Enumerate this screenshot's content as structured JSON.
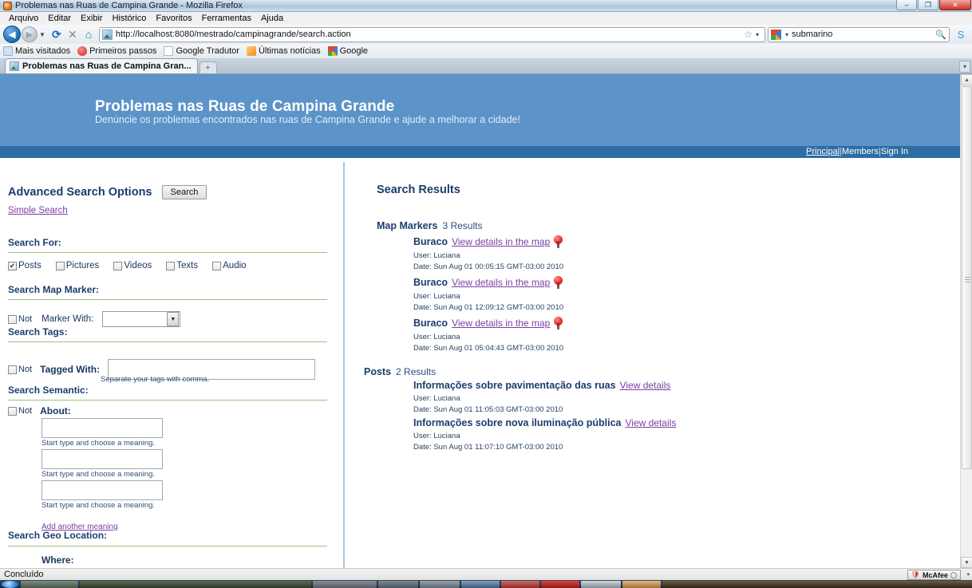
{
  "window": {
    "title": "Problemas nas Ruas de Campina Grande - Mozilla Firefox",
    "minimize": "–",
    "maximize": "❐",
    "close": "✕"
  },
  "menu": [
    "Arquivo",
    "Editar",
    "Exibir",
    "Histórico",
    "Favoritos",
    "Ferramentas",
    "Ajuda"
  ],
  "toolbar": {
    "back_icon": "◀",
    "forward_icon": "▶",
    "dropdown_caret": "▼",
    "reload_icon": "⟳",
    "stop_icon": "✕",
    "home_icon": "⌂",
    "url": "http://localhost:8080/mestrado/campinagrande/search.action",
    "star_icon": "☆",
    "star_caret": "▾",
    "search_engine_caret": "▾",
    "search_value": "submarino",
    "search_icon": "🔍",
    "extension_icon": "S"
  },
  "bookmarks": [
    {
      "label": "Mais visitados",
      "icon": "blue"
    },
    {
      "label": "Primeiros passos",
      "icon": "red"
    },
    {
      "label": "Google Tradutor",
      "icon": "page"
    },
    {
      "label": "Últimas notícias",
      "icon": "rss"
    },
    {
      "label": "Google",
      "icon": "g"
    }
  ],
  "tabs": {
    "active_label": "Problemas nas Ruas de Campina Gran...",
    "new_tab_icon": "+",
    "list_all_icon": "▾"
  },
  "page": {
    "title": "Problemas nas Ruas de Campina Grande",
    "subtitle": "Denúncie os problemas encontrados nas ruas de Campina Grande e ajude a melhorar a cidade!",
    "nav": {
      "principal": "Principal",
      "members": "Members",
      "signin": "Sign In",
      "separator": "|"
    }
  },
  "sidebar": {
    "heading": "Advanced Search Options",
    "search_button": "Search",
    "simple_search_link": "Simple Search",
    "search_for": {
      "heading": "Search For:",
      "options": [
        {
          "label": "Posts",
          "checked": true
        },
        {
          "label": "Pictures",
          "checked": false
        },
        {
          "label": "Videos",
          "checked": false
        },
        {
          "label": "Texts",
          "checked": false
        },
        {
          "label": "Audio",
          "checked": false
        }
      ]
    },
    "map_marker": {
      "heading": "Search Map Marker:",
      "not_label": "Not",
      "field_label": "Marker With:",
      "select_value": "",
      "select_caret": "▼"
    },
    "tags": {
      "heading": "Search Tags:",
      "not_label": "Not",
      "field_label": "Tagged With:",
      "input_value": "",
      "hint": "Separate your tags with comma."
    },
    "semantic": {
      "heading": "Search Semantic:",
      "not_label": "Not",
      "field_label": "About:",
      "meanings": [
        {
          "value": "",
          "hint": "Start type and choose a meaning."
        },
        {
          "value": "",
          "hint": "Start type and choose a meaning."
        },
        {
          "value": "",
          "hint": "Start type and choose a meaning."
        }
      ],
      "add_link": "Add another meaning"
    },
    "geo": {
      "heading": "Search Geo Location:",
      "where_label": "Where:"
    }
  },
  "results": {
    "heading": "Search Results",
    "groups": [
      {
        "name": "Map Markers",
        "count": "3 Results",
        "items": [
          {
            "title": "Buraco",
            "link": "View details in the map",
            "has_pin": true,
            "user": "User: Luciana",
            "date": "Date: Sun Aug 01 00:05:15 GMT-03:00 2010"
          },
          {
            "title": "Buraco",
            "link": "View details in the map",
            "has_pin": true,
            "user": "User: Luciana",
            "date": "Date: Sun Aug 01 12:09:12 GMT-03:00 2010"
          },
          {
            "title": "Buraco",
            "link": "View details in the map",
            "has_pin": true,
            "user": "User: Luciana",
            "date": "Date: Sun Aug 01 05:04:43 GMT-03:00 2010"
          }
        ]
      },
      {
        "name": "Posts",
        "count": "2 Results",
        "items": [
          {
            "title": "Informações sobre pavimentação das ruas",
            "link": "View details",
            "has_pin": false,
            "user": "User: Luciana",
            "date": "Date: Sun Aug 01 11:05:03 GMT-03:00 2010"
          },
          {
            "title": "Informações sobre nova iluminação pública",
            "link": "View details",
            "has_pin": false,
            "user": "User: Luciana",
            "date": "Date: Sun Aug 01 11:07:10 GMT-03:00 2010"
          }
        ]
      }
    ]
  },
  "scrollbar": {
    "up_icon": "▲",
    "down_icon": "▼"
  },
  "status": {
    "text": "Concluído",
    "mcafee_label": "McAfee",
    "shield_icon": "🛡",
    "caret_icon": "▾"
  },
  "colors": {
    "header_blue": "#5c93c9",
    "nav_blue": "#2e6da4",
    "heading_navy": "#1b3d6e",
    "link_purple": "#7b3fa0",
    "rule_green": "#9fbf7f",
    "pin_red": "#e8322c"
  }
}
